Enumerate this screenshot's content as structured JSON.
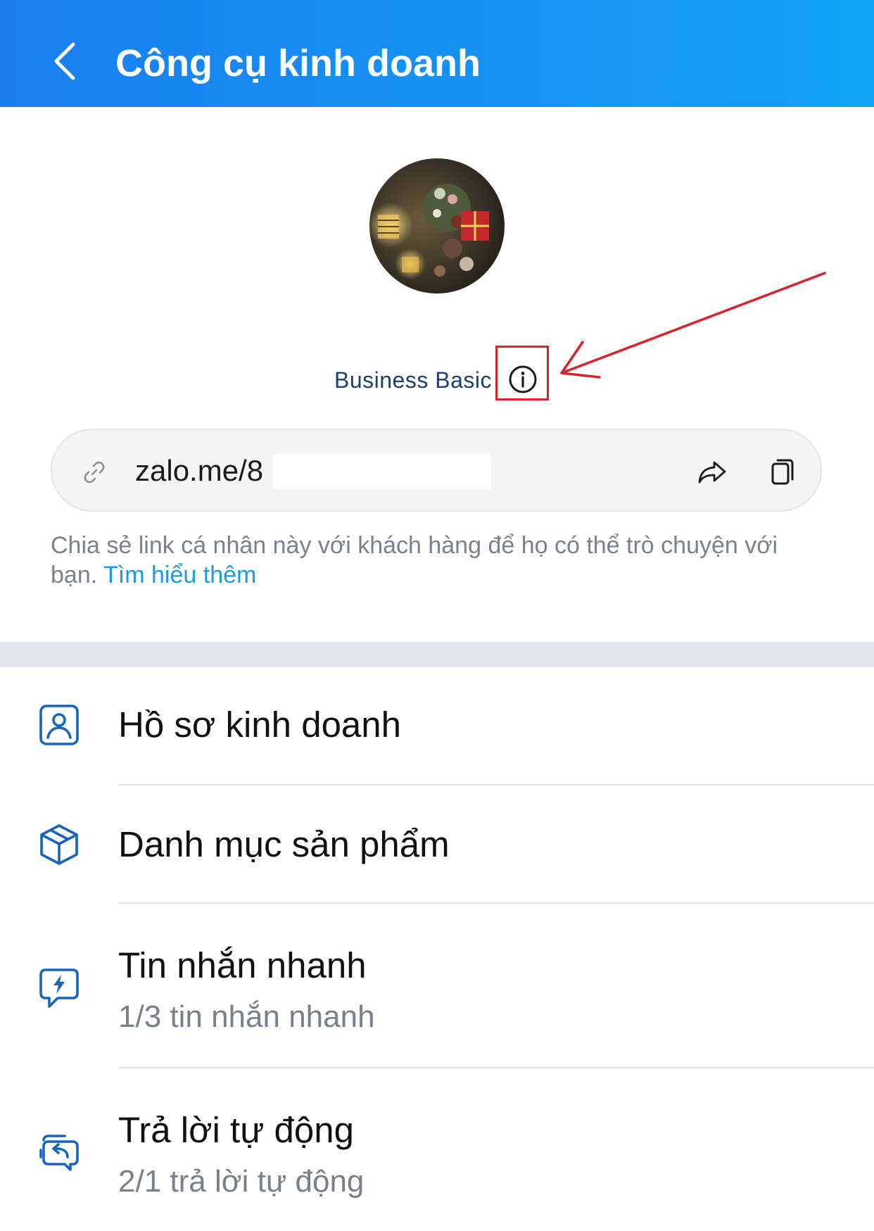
{
  "header": {
    "title": "Công cụ kinh doanh",
    "back_icon": "chevron-left-icon"
  },
  "profile": {
    "plan_label": "Business Basic",
    "info_icon": "info-icon"
  },
  "link": {
    "url_text": "zalo.me/8",
    "link_icon": "link-icon",
    "share_icon": "share-icon",
    "copy_icon": "copy-icon"
  },
  "helper": {
    "text": "Chia sẻ link cá nhân này với khách hàng để họ có thể trò chuyện với bạn.",
    "learn_more": "Tìm hiểu thêm"
  },
  "menu": {
    "items": [
      {
        "title": "Hồ sơ kinh doanh",
        "subtitle": "",
        "icon": "profile-card-icon"
      },
      {
        "title": "Danh mục sản phẩm",
        "subtitle": "",
        "icon": "box-icon"
      },
      {
        "title": "Tin nhắn nhanh",
        "subtitle": "1/3 tin nhắn nhanh",
        "icon": "quick-message-icon"
      },
      {
        "title": "Trả lời tự động",
        "subtitle": "2/1 trả lời tự động",
        "icon": "auto-reply-icon"
      }
    ]
  },
  "colors": {
    "header_start": "#1a7ef0",
    "header_end": "#12a3f6",
    "accent_blue": "#1b9ae6",
    "plan_text": "#1d3f73",
    "icon_blue": "#1565c0",
    "annotation_red": "#d8232a"
  }
}
